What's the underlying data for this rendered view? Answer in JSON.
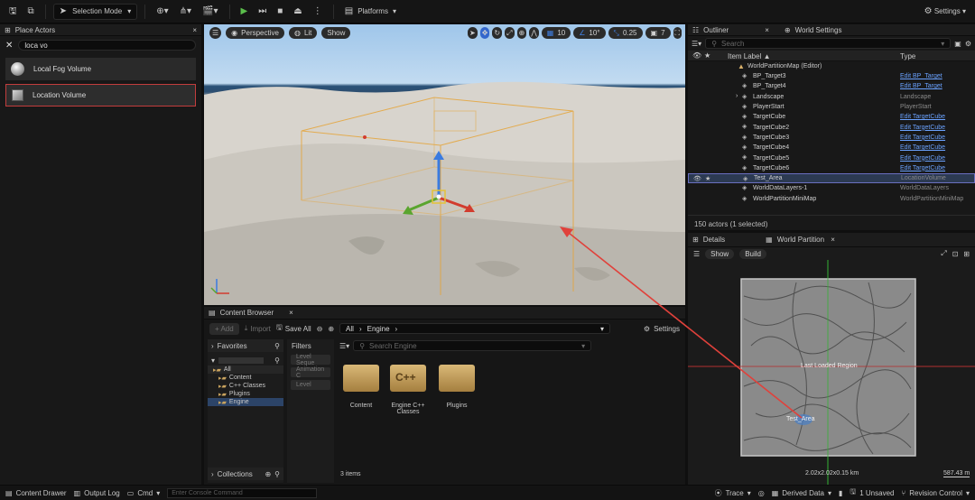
{
  "toolbar": {
    "selection_mode": "Selection Mode",
    "platforms": "Platforms",
    "settings": "Settings"
  },
  "place_actors": {
    "tab": "Place Actors",
    "search_value": "loca vo",
    "items": [
      {
        "label": "Local Fog Volume"
      },
      {
        "label": "Location Volume"
      }
    ]
  },
  "viewport": {
    "perspective": "Perspective",
    "lit": "Lit",
    "show": "Show",
    "grid": "10",
    "rot": "10°",
    "scale": "0.25",
    "cam": "7"
  },
  "outliner": {
    "tab": "Outliner",
    "tab2": "World Settings",
    "search_placeholder": "Search",
    "col_label": "Item Label ▲",
    "col_type": "Type",
    "map": "WorldPartitionMap (Editor)",
    "rows": [
      {
        "label": "BP_Target3",
        "type": "Edit BP_Target"
      },
      {
        "label": "BP_Target4",
        "type": "Edit BP_Target"
      },
      {
        "label": "Landscape",
        "type": "Landscape"
      },
      {
        "label": "PlayerStart",
        "type": "PlayerStart"
      },
      {
        "label": "TargetCube",
        "type": "Edit TargetCube"
      },
      {
        "label": "TargetCube2",
        "type": "Edit TargetCube"
      },
      {
        "label": "TargetCube3",
        "type": "Edit TargetCube"
      },
      {
        "label": "TargetCube4",
        "type": "Edit TargetCube"
      },
      {
        "label": "TargetCube5",
        "type": "Edit TargetCube"
      },
      {
        "label": "TargetCube6",
        "type": "Edit TargetCube"
      },
      {
        "label": "Test_Area",
        "type": "LocationVolume"
      },
      {
        "label": "WorldDataLayers-1",
        "type": "WorldDataLayers"
      },
      {
        "label": "WorldPartitionMiniMap",
        "type": "WorldPartitionMiniMap"
      }
    ],
    "footer": "150 actors (1 selected)"
  },
  "world_partition": {
    "tab_details": "Details",
    "tab_wp": "World Partition",
    "show": "Show",
    "build": "Build",
    "region_label": "Last Loaded Region",
    "area_label": "Test_Area",
    "dims": "2.02x2.02x0.15 km",
    "scale": "587.43 m"
  },
  "content_browser": {
    "tab": "Content Browser",
    "add": "+ Add",
    "import": "Import",
    "save_all": "Save All",
    "path_all": "All",
    "path_engine": "Engine",
    "settings": "Settings",
    "favorites": "Favorites",
    "filters": "Filters",
    "filter_items": [
      "Level Seque",
      "Animation C",
      "Level"
    ],
    "tree": [
      "All",
      "Content",
      "C++ Classes",
      "Plugins",
      "Engine"
    ],
    "search_placeholder": "Search Engine",
    "folders": [
      {
        "label": "Content"
      },
      {
        "label": "Engine C++ Classes",
        "badge": "C++"
      },
      {
        "label": "Plugins"
      }
    ],
    "count": "3 items",
    "collections": "Collections"
  },
  "status": {
    "content_drawer": "Content Drawer",
    "output_log": "Output Log",
    "cmd": "Cmd",
    "console_placeholder": "Enter Console Command",
    "trace": "Trace",
    "derived_data": "Derived Data",
    "unsaved": "1 Unsaved",
    "revision": "Revision Control"
  },
  "colors": {
    "accent_red": "#c23d3d",
    "link_blue": "#6aa2ff",
    "play_green": "#5bbf4c",
    "folder": "#c9a35e"
  }
}
